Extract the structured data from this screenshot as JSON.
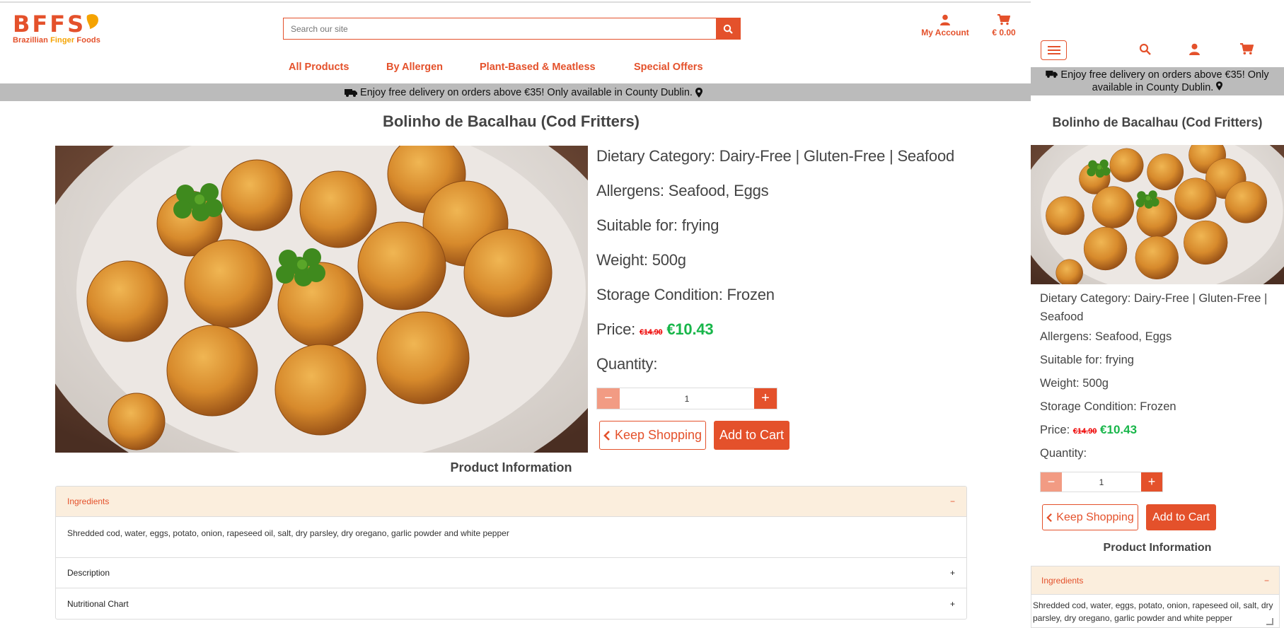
{
  "brand": {
    "letters": "BFFS",
    "tagline_part1": "Brazillian ",
    "tagline_part2": "Finger",
    "tagline_part3": " Foods"
  },
  "search": {
    "placeholder": "Search our site"
  },
  "header": {
    "account_label": "My Account",
    "cart_total": "€ 0.00"
  },
  "nav": [
    "All Products",
    "By Allergen",
    "Plant-Based & Meatless",
    "Special Offers"
  ],
  "banner": {
    "text": "Enjoy free delivery on orders above €35! Only available in County Dublin.",
    "mobile_line1": "Enjoy free delivery on orders above €35! Only",
    "mobile_line2": "available in County Dublin."
  },
  "product": {
    "title": "Bolinho de Bacalhau (Cod Fritters)",
    "dietary": "Dietary Category: Dairy-Free | Gluten-Free | Seafood",
    "dietary_mobile_1": "Dietary Category: Dairy-Free | Gluten-Free |",
    "dietary_mobile_2": "Seafood",
    "allergens": "Allergens: Seafood, Eggs",
    "suitable": "Suitable for: frying",
    "weight": "Weight: 500g",
    "storage": "Storage Condition: Frozen",
    "price_label": "Price:",
    "price_old": "€14.90",
    "price_new": "€10.43",
    "quantity_label": "Quantity:",
    "quantity": "1"
  },
  "buttons": {
    "keep_shopping": "Keep Shopping",
    "add_to_cart": "Add to Cart",
    "minus": "−",
    "plus": "+"
  },
  "info": {
    "heading": "Product Information",
    "sections": [
      {
        "title": "Ingredients",
        "state": "open",
        "toggle": "−",
        "body": "Shredded cod, water, eggs, potato, onion, rapeseed oil, salt, dry parsley, dry oregano, garlic powder and white pepper"
      },
      {
        "title": "Description",
        "state": "closed",
        "toggle": "+"
      },
      {
        "title": "Nutritional Chart",
        "state": "closed",
        "toggle": "+"
      }
    ],
    "mobile_body_line1": "Shredded cod, water, eggs, potato, onion, rapeseed oil, salt, dry",
    "mobile_body_line2": "parsley, dry oregano, garlic powder and white pepper"
  },
  "colors": {
    "accent": "#e4512b",
    "accent_light": "#f29b83",
    "price_green": "#18b64a",
    "price_red": "#ee0000",
    "banner_bg": "#bbbbbb",
    "accordion_open_bg": "#fbeedd"
  },
  "icons": [
    "search-icon",
    "user-icon",
    "cart-icon",
    "truck-icon",
    "map-pin-icon",
    "chevron-left-icon",
    "menu-icon"
  ]
}
